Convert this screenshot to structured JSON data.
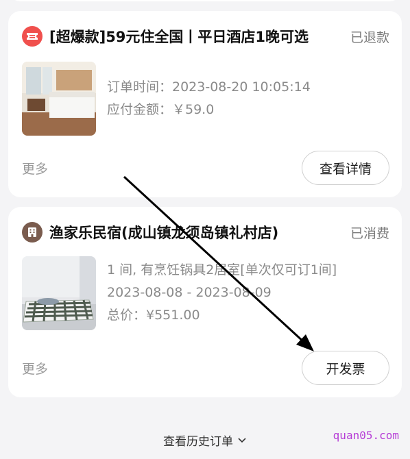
{
  "orders": [
    {
      "shop_icon": "ticket-icon",
      "shop_name": "[超爆款]59元住全国丨平日酒店1晚可选",
      "status": "已退款",
      "thumbnail": "hotel-room-photo",
      "info": [
        "订单时间：2023-08-20 10:05:14",
        "应付金额：￥59.0"
      ],
      "more_label": "更多",
      "action_label": "查看详情"
    },
    {
      "shop_icon": "building-icon",
      "shop_name": "渔家乐民宿(成山镇龙须岛镇礼村店)",
      "status": "已消费",
      "thumbnail": "bedroom-mattress-photo",
      "info": [
        "1 间, 有烹饪锅具2居室[单次仅可订1间]",
        "2023-08-08 - 2023-08-09",
        "总价：¥551.00"
      ],
      "more_label": "更多",
      "action_label": "开发票"
    }
  ],
  "history_link": "查看历史订单",
  "watermark": "quan05.com",
  "colors": {
    "ticket_icon_bg": "#f0504d",
    "building_icon_bg": "#7a5c4e",
    "page_bg": "#f4f4f6",
    "watermark": "#b53bd6"
  }
}
